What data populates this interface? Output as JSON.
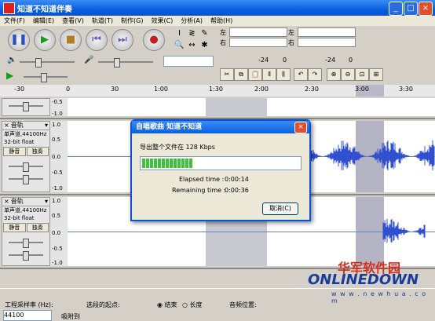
{
  "window": {
    "title": "知道不知道伴奏",
    "controls": [
      "_",
      "□",
      "×"
    ]
  },
  "menu": [
    "文件(F)",
    "编辑(E)",
    "查看(V)",
    "轨道(T)",
    "制作(G)",
    "效果(C)",
    "分析(A)",
    "帮助(H)"
  ],
  "transport": {
    "pause": "❚❚",
    "play": "▶",
    "stop": "■",
    "skip_start": "⏮",
    "skip_end": "⏭",
    "record": "●"
  },
  "tools": {
    "row1": [
      "I",
      "≷",
      "✎"
    ],
    "row2": [
      "🔍",
      "↔",
      "✱"
    ]
  },
  "meters": {
    "left_label": "左",
    "right_label": "右",
    "play_scale": [
      "-24",
      "0"
    ],
    "rec_scale": [
      "-24",
      "0"
    ]
  },
  "mixer": {
    "vol_icon": "🔈",
    "mic_icon": "🎤",
    "input_label": ""
  },
  "edit_tools": [
    "✂",
    "⧉",
    "📋",
    "⫴",
    "⫼",
    "↶",
    "↷",
    "⊕",
    "⊖",
    "⊡",
    "⊞"
  ],
  "ruler": {
    "ticks": [
      "-30",
      "0",
      "30",
      "1:00",
      "1:30",
      "2:00",
      "2:30",
      "3:00",
      "3:30"
    ]
  },
  "tracks": [
    {
      "name": "",
      "scale": [
        "-0.5",
        "-1.0"
      ]
    },
    {
      "name": "音轨",
      "rate": "单声道,44100Hz",
      "format": "32-bit float",
      "mute": "静音",
      "solo": "独奏",
      "scale": [
        "1.0",
        "0.5",
        "0.0",
        "-0.5",
        "-1.0"
      ]
    },
    {
      "name": "音轨",
      "rate": "单声道,44100Hz",
      "format": "32-bit float",
      "mute": "静音",
      "solo": "独奏",
      "scale": [
        "1.0",
        "0.5",
        "0.0",
        "-0.5",
        "-1.0"
      ]
    }
  ],
  "status": {
    "rate_label": "工程采样率 (Hz):",
    "rate_value": "44100",
    "sel_start_label": "选段的起点:",
    "end_option": "结束",
    "length_option": "长度",
    "audio_pos_label": "音频位置:",
    "snap_label": "吸附到"
  },
  "dialog": {
    "title": "自唱歌曲  知道不知道",
    "message": "导出整个文件在 128 Kbps",
    "progress": 0.33,
    "elapsed_label": "Elapsed time :",
    "elapsed_value": "0:00:14",
    "remaining_label": "Remaining time :",
    "remaining_value": "0:00:36",
    "cancel": "取消(C)"
  },
  "watermark": {
    "cn": "华军软件园",
    "en": "ONLINEDOWN",
    "url": "w w w . n e w h u a . c o m"
  },
  "colors": {
    "titlebar": "#0a5fe0",
    "progress": "#3cc33c",
    "waveform": "#3050d0"
  }
}
